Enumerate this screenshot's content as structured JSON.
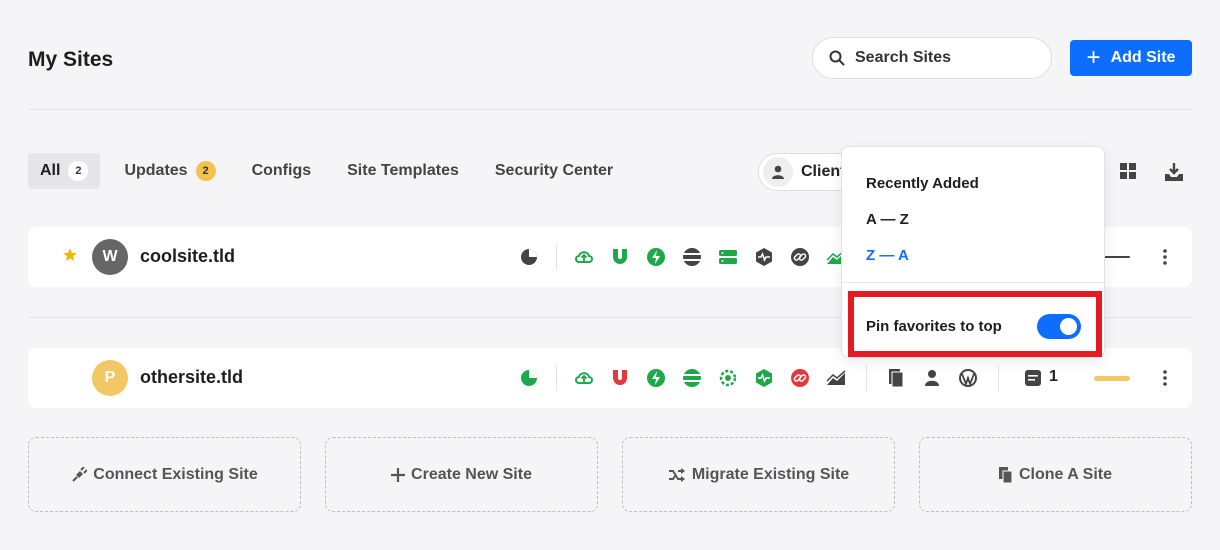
{
  "header": {
    "title": "My Sites",
    "search_placeholder": "Search Sites",
    "add_site_label": "Add Site"
  },
  "tabs": [
    {
      "label": "All",
      "badge": "2"
    },
    {
      "label": "Updates",
      "badge": "2"
    },
    {
      "label": "Configs"
    },
    {
      "label": "Site Templates"
    },
    {
      "label": "Security Center"
    }
  ],
  "filter": {
    "client_label": "Client"
  },
  "sites": [
    {
      "initial": "W",
      "name": "coolsite.tld",
      "favorite": true,
      "avatar_color": "#666666"
    },
    {
      "initial": "P",
      "name": "othersite.tld",
      "favorite": false,
      "avatar_color": "#f2c864",
      "count": "1"
    }
  ],
  "actions": [
    {
      "label": "Connect Existing Site"
    },
    {
      "label": "Create New Site"
    },
    {
      "label": "Migrate Existing Site"
    },
    {
      "label": "Clone A Site"
    }
  ],
  "sort_menu": {
    "options": [
      "Recently Added",
      "A — Z",
      "Z — A"
    ],
    "selected": "Z — A",
    "pin_label": "Pin favorites to top",
    "pin_enabled": true
  },
  "colors": {
    "accent": "#0d6efd",
    "green": "#1fa84a",
    "red": "#e5383b",
    "highlight": "#e41b23",
    "star": "#f2b800"
  }
}
